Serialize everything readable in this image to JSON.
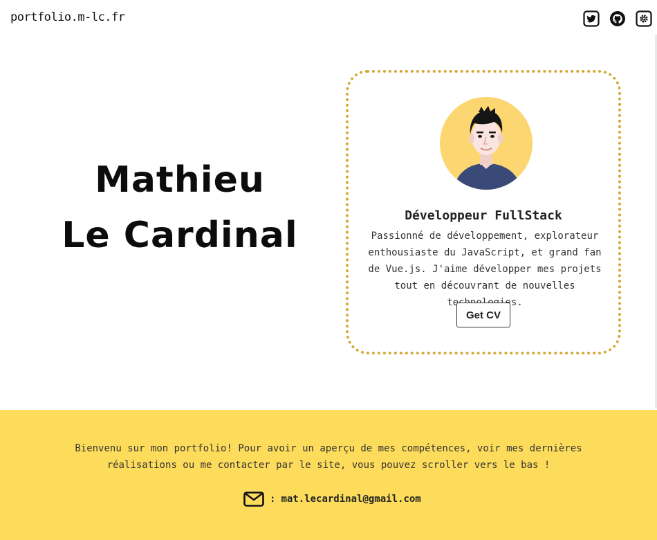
{
  "header": {
    "site_name": "portfolio.m-lc.fr",
    "icons": [
      "twitter-icon",
      "github-icon",
      "gear-icon"
    ]
  },
  "hero": {
    "first_name": "Mathieu",
    "last_name": "Le Cardinal"
  },
  "profile_card": {
    "avatar": "avatar-illustration",
    "title": "Développeur FullStack",
    "description": "Passionné de développement, explorateur enthousiaste du JavaScript, et grand fan de Vue.js. J'aime développer mes projets tout en découvrant de nouvelles technologies.",
    "cv_button": "Get CV"
  },
  "intro": {
    "text": "Bienvenu sur mon portfolio! Pour avoir un aperçu de mes compétences, voir mes dernières réalisations ou me contacter par le site, vous pouvez scroller vers le bas !",
    "contact_separator": ":",
    "email": "mat.lecardinal@gmail.com",
    "contact_icon": "mail-icon"
  },
  "colors": {
    "accent_yellow": "#fddc5c",
    "card_border": "#d4a732",
    "avatar_bg": "#fcd671",
    "text_dark": "#111111"
  }
}
